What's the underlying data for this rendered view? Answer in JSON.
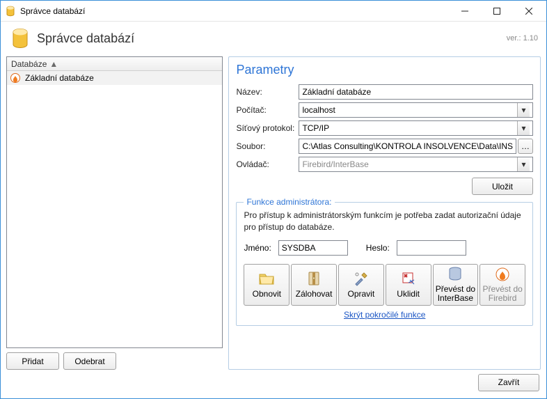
{
  "window": {
    "title": "Správce databází",
    "version": "ver.: 1.10",
    "header": "Správce databází"
  },
  "left": {
    "column_header": "Databáze",
    "items": [
      "Základní databáze"
    ],
    "btn_add": "Přidat",
    "btn_remove": "Odebrat"
  },
  "params": {
    "title": "Parametry",
    "labels": {
      "name": "Název:",
      "host": "Počítač:",
      "proto": "Síťový protokol:",
      "file": "Soubor:",
      "driver": "Ovládač:"
    },
    "values": {
      "name": "Základní databáze",
      "host": "localhost",
      "proto": "TCP/IP",
      "file": "C:\\Atlas Consulting\\KONTROLA INSOLVENCE\\Data\\INS",
      "driver": "Firebird/InterBase"
    },
    "btn_save": "Uložit"
  },
  "admin": {
    "legend": "Funkce administrátora:",
    "desc": "Pro přístup k administrátorským funkcím je potřeba zadat autorizační údaje pro přístup do databáze.",
    "user_label": "Jméno:",
    "user_value": "SYSDBA",
    "pass_label": "Heslo:",
    "buttons": {
      "restore": "Obnovit",
      "backup": "Zálohovat",
      "repair": "Opravit",
      "clean": "Uklidit",
      "to_interbase": "Převést do InterBase",
      "to_firebird": "Převést do Firebird"
    },
    "link": "Skrýt pokročilé funkce"
  },
  "footer": {
    "close": "Zavřít"
  }
}
